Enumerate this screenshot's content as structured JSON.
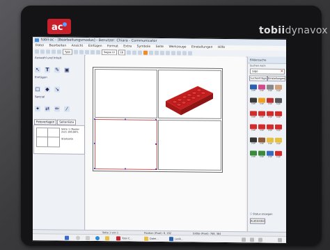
{
  "device": {
    "brand_bold": "tobii",
    "brand_light": "dynavox"
  },
  "window": {
    "title": "tobii-ac - [Bearbeitungsmodus] - Benutzer: Chiara - Communicator"
  },
  "menu": [
    "Datei",
    "Bearbeiten",
    "Ansicht",
    "Einfügen",
    "Format",
    "Extra",
    "Symbole",
    "Seite",
    "Werkzeuge",
    "Einstellungen",
    "Hilfe"
  ],
  "toolbar": {
    "font_select": "Typo",
    "font_select2": "Segoe UI",
    "size_select": "16"
  },
  "left_panel": {
    "section1": "Auswahl und Inhalt",
    "section2": "Einfügen",
    "section3": "Spezial",
    "tabs": [
      "Fotoverlagen",
      "Seitenliste"
    ],
    "page_entry": "Seite 1 (Raster 2x2) 100,00%",
    "page_entry2": "Startseite"
  },
  "right_panel": {
    "header": "Bildersuche",
    "search_label": "Suchen nach",
    "search_value": "Lego",
    "tabs": [
      "Sucheinträge",
      "Einstellungen"
    ],
    "symbols": [
      "Lego",
      "Lego",
      "Lego",
      "Lego",
      "Lego",
      "Lego",
      "Lego",
      "Lego",
      "Lego",
      "Lego",
      "Lego",
      "Lego",
      "Lego",
      "Lego",
      "Lego",
      "Lego",
      "Lego",
      "Lego",
      "Lego",
      "Lego",
      "Lego",
      "Lego",
      "Lego",
      "Lego"
    ],
    "checkbox_label": "Status anzeigen",
    "button_label": "Ausblenden"
  },
  "statusbar": {
    "left": "Seite 1 von 1",
    "mid": "Position (Pixel): 0, 192",
    "right": "Größe (Pixel): 768, 384"
  },
  "taskbar": {
    "items": [
      "Tobii C...",
      "Datei...",
      "Lexik..."
    ]
  },
  "colors": {
    "lego_red": "#d42a2a",
    "accent_blue": "#4a8ad6",
    "selection_red": "#d05050"
  }
}
